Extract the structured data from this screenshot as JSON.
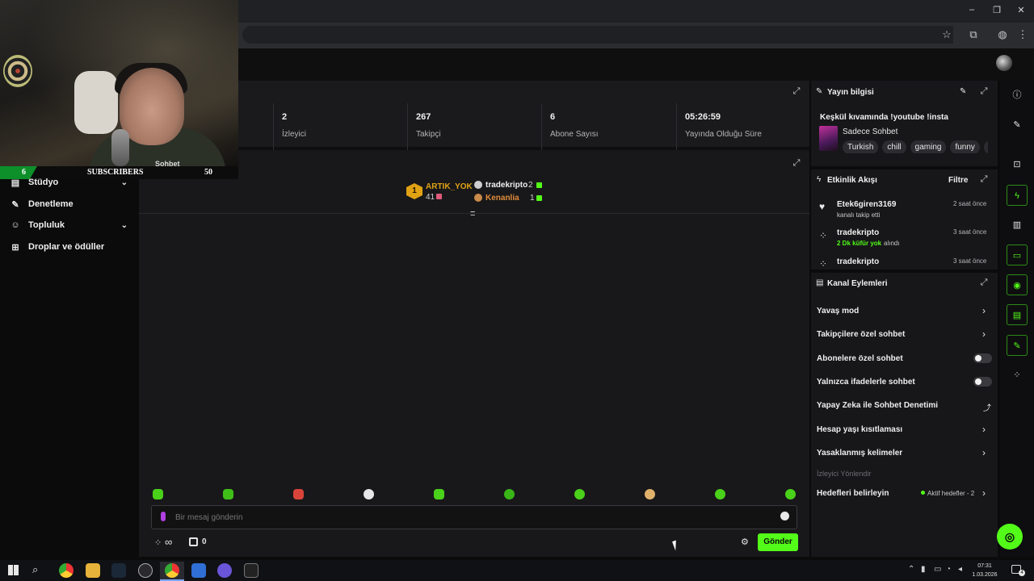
{
  "browser": {
    "window_controls": [
      "–",
      "❐",
      "✕"
    ],
    "toolbar_icons": [
      "star-icon",
      "extensions-icon",
      "profile-icon",
      "menu-icon"
    ]
  },
  "overlay": {
    "sub_count_left": "6",
    "sub_label": "SUBSCRIBERS",
    "sub_count_right": "50",
    "partial_under_overlay": "Sohbet"
  },
  "sidebar": {
    "items": [
      {
        "label": "Stüdyo",
        "icon": "studio-icon",
        "has_chevron": true
      },
      {
        "label": "Denetleme",
        "icon": "wrench-icon",
        "has_chevron": false
      },
      {
        "label": "Topluluk",
        "icon": "community-icon",
        "has_chevron": true
      },
      {
        "label": "Droplar ve ödüller",
        "icon": "gift-icon",
        "has_chevron": false
      }
    ]
  },
  "stats": [
    {
      "value": "2",
      "label": "İzleyici"
    },
    {
      "value": "267",
      "label": "Takipçi"
    },
    {
      "value": "6",
      "label": "Abone Sayısı"
    },
    {
      "value": "05:26:59",
      "label": "Yayında Olduğu Süre"
    }
  ],
  "leaderboard": {
    "rank": "1",
    "first": {
      "name": "ARTIK_YOK",
      "count": "41"
    },
    "second": {
      "name": "tradekripto",
      "count": "2"
    },
    "third": {
      "name": "Kenanlia",
      "count": "1"
    }
  },
  "chat": {
    "placeholder": "Bir mesaj gönderin",
    "send_label": "Gönder",
    "points_value": "∞",
    "store_value": "0"
  },
  "stream_info": {
    "title": "Yayın bilgisi",
    "stream_title": "Keşkül kıvamında !youtube !insta",
    "category": "Sadece Sohbet",
    "tags": [
      "Turkish",
      "chill",
      "gaming",
      "funny",
      "T"
    ]
  },
  "activity": {
    "title": "Etkinlik Akışı",
    "filter_label": "Filtre",
    "events": [
      {
        "user": "Etek6giren3169",
        "detail_plain": "kanalı takip etti",
        "detail_highlight": "",
        "time": "2 saat önce",
        "icon": "heart-icon"
      },
      {
        "user": "tradekripto",
        "detail_highlight": "2 Dk küfür yok",
        "detail_plain": "alındı",
        "time": "3 saat önce",
        "icon": "points-icon"
      },
      {
        "user": "tradekripto",
        "detail_highlight": "",
        "detail_plain": "",
        "time": "3 saat önce",
        "icon": "points-icon"
      }
    ]
  },
  "channel_actions": {
    "title": "Kanal Eylemleri",
    "rows": [
      {
        "label": "Yavaş mod",
        "control": "chevron"
      },
      {
        "label": "Takipçilere özel sohbet",
        "control": "chevron"
      },
      {
        "label": "Abonelere özel sohbet",
        "control": "toggle",
        "on": false
      },
      {
        "label": "Yalnızca ifadelerle sohbet",
        "control": "toggle",
        "on": false
      },
      {
        "label": "Yapay Zeka ile Sohbet Denetimi",
        "control": "external"
      },
      {
        "label": "Hesap yaşı kısıtlaması",
        "control": "chevron"
      },
      {
        "label": "Yasaklanmış kelimeler",
        "control": "chevron"
      }
    ],
    "section_label": "İzleyici Yönlendir",
    "goals_label": "Hedefleri belirleyin",
    "goals_status": "Aktif hedefler - 2"
  },
  "taskbar": {
    "time": "07:31",
    "date": "1.03.2026",
    "notification_count": "4"
  },
  "colors": {
    "accent": "#53fc18",
    "gold": "#e0a214",
    "panel": "#17171a"
  }
}
